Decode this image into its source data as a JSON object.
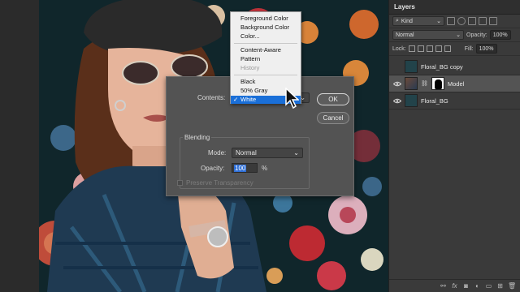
{
  "layers_panel": {
    "title": "Layers",
    "filter_kind": "Kind",
    "blend_mode": "Normal",
    "opacity_label": "Opacity:",
    "opacity_value": "100%",
    "lock_label": "Lock:",
    "fill_label": "Fill:",
    "fill_value": "100%",
    "layers": [
      {
        "name": "Floral_BG copy",
        "visible": false,
        "selected": false
      },
      {
        "name": "Model",
        "visible": true,
        "selected": true
      },
      {
        "name": "Floral_BG",
        "visible": true,
        "selected": false
      }
    ],
    "footer_icons": [
      "link-icon",
      "fx-icon",
      "mask-icon",
      "adjustment-icon",
      "folder-icon",
      "new-layer-icon",
      "trash-icon"
    ],
    "footer_fx": "fx"
  },
  "fill_dialog": {
    "contents_label": "Contents:",
    "ok_label": "OK",
    "cancel_label": "Cancel",
    "blending_label": "Blending",
    "mode_label": "Mode:",
    "mode_value": "Normal",
    "opacity_label": "Opacity:",
    "opacity_value": "100",
    "opacity_unit": "%",
    "preserve_label": "Preserve Transparency"
  },
  "contents_menu": {
    "items": [
      {
        "label": "Foreground Color",
        "disabled": false
      },
      {
        "label": "Background Color",
        "disabled": false
      },
      {
        "label": "Color...",
        "disabled": false
      },
      {
        "label": "Content-Aware",
        "disabled": false
      },
      {
        "label": "Pattern",
        "disabled": false
      },
      {
        "label": "History",
        "disabled": true
      },
      {
        "label": "Black",
        "disabled": false
      },
      {
        "label": "50% Gray",
        "disabled": false
      },
      {
        "label": "White",
        "disabled": false,
        "selected": true
      }
    ]
  },
  "colors": {
    "accent": "#1a6fd8",
    "panel_bg": "#3a3a3a",
    "dialog_bg": "#535353"
  }
}
